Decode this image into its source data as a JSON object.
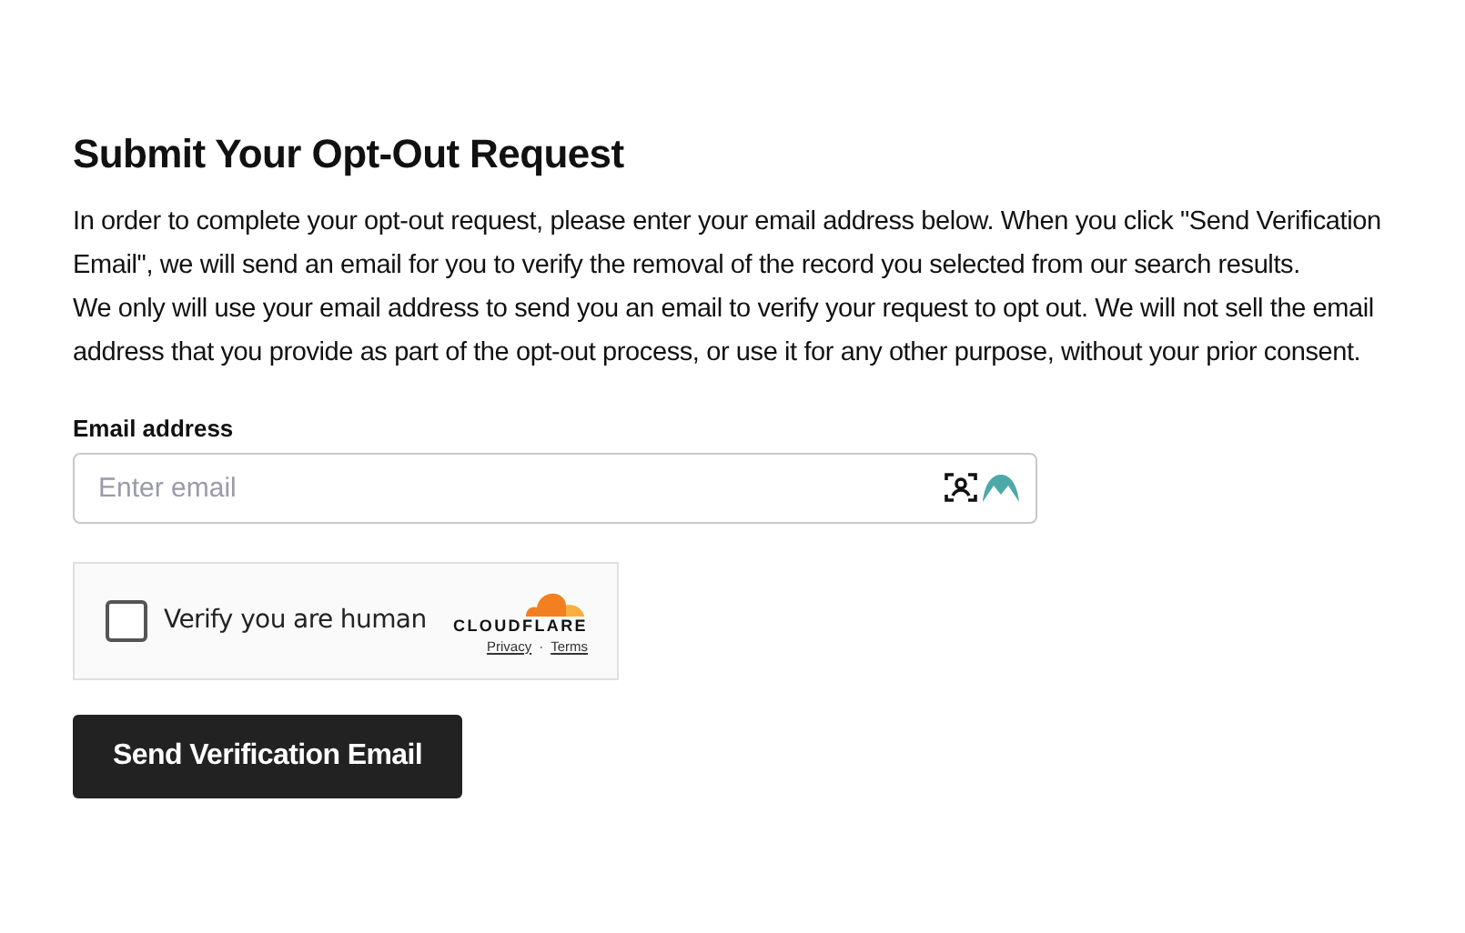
{
  "heading": "Submit Your Opt-Out Request",
  "paragraphs": [
    "In order to complete your opt-out request, please enter your email address below. When you click \"Send Verification Email\", we will send an email for you to verify the removal of the record you selected from our search results.",
    "We only will use your email address to send you an email to verify your request to opt out. We will not sell the email address that you provide as part of the opt-out process, or use it for any other purpose, without your prior consent."
  ],
  "email": {
    "label": "Email address",
    "placeholder": "Enter email"
  },
  "captcha": {
    "label": "Verify you are human",
    "checked": false,
    "brand": "CLOUDFLARE",
    "links": [
      "Privacy",
      "Terms"
    ],
    "separator": "·"
  },
  "submit": "Send Verification Email"
}
